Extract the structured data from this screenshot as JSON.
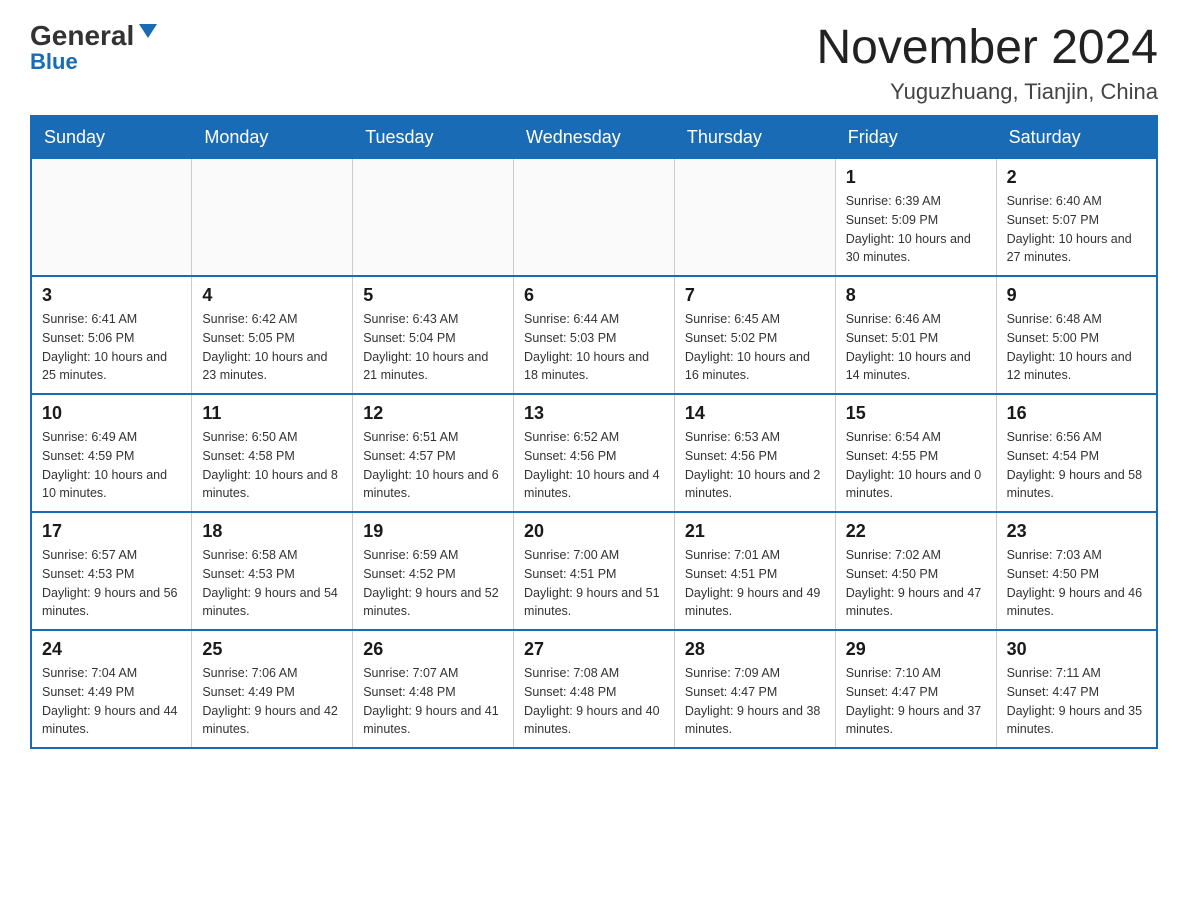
{
  "header": {
    "logo_general": "General",
    "logo_blue": "Blue",
    "month_year": "November 2024",
    "location": "Yuguzhuang, Tianjin, China"
  },
  "days_of_week": [
    "Sunday",
    "Monday",
    "Tuesday",
    "Wednesday",
    "Thursday",
    "Friday",
    "Saturday"
  ],
  "weeks": [
    [
      {
        "day": "",
        "info": ""
      },
      {
        "day": "",
        "info": ""
      },
      {
        "day": "",
        "info": ""
      },
      {
        "day": "",
        "info": ""
      },
      {
        "day": "",
        "info": ""
      },
      {
        "day": "1",
        "info": "Sunrise: 6:39 AM\nSunset: 5:09 PM\nDaylight: 10 hours and 30 minutes."
      },
      {
        "day": "2",
        "info": "Sunrise: 6:40 AM\nSunset: 5:07 PM\nDaylight: 10 hours and 27 minutes."
      }
    ],
    [
      {
        "day": "3",
        "info": "Sunrise: 6:41 AM\nSunset: 5:06 PM\nDaylight: 10 hours and 25 minutes."
      },
      {
        "day": "4",
        "info": "Sunrise: 6:42 AM\nSunset: 5:05 PM\nDaylight: 10 hours and 23 minutes."
      },
      {
        "day": "5",
        "info": "Sunrise: 6:43 AM\nSunset: 5:04 PM\nDaylight: 10 hours and 21 minutes."
      },
      {
        "day": "6",
        "info": "Sunrise: 6:44 AM\nSunset: 5:03 PM\nDaylight: 10 hours and 18 minutes."
      },
      {
        "day": "7",
        "info": "Sunrise: 6:45 AM\nSunset: 5:02 PM\nDaylight: 10 hours and 16 minutes."
      },
      {
        "day": "8",
        "info": "Sunrise: 6:46 AM\nSunset: 5:01 PM\nDaylight: 10 hours and 14 minutes."
      },
      {
        "day": "9",
        "info": "Sunrise: 6:48 AM\nSunset: 5:00 PM\nDaylight: 10 hours and 12 minutes."
      }
    ],
    [
      {
        "day": "10",
        "info": "Sunrise: 6:49 AM\nSunset: 4:59 PM\nDaylight: 10 hours and 10 minutes."
      },
      {
        "day": "11",
        "info": "Sunrise: 6:50 AM\nSunset: 4:58 PM\nDaylight: 10 hours and 8 minutes."
      },
      {
        "day": "12",
        "info": "Sunrise: 6:51 AM\nSunset: 4:57 PM\nDaylight: 10 hours and 6 minutes."
      },
      {
        "day": "13",
        "info": "Sunrise: 6:52 AM\nSunset: 4:56 PM\nDaylight: 10 hours and 4 minutes."
      },
      {
        "day": "14",
        "info": "Sunrise: 6:53 AM\nSunset: 4:56 PM\nDaylight: 10 hours and 2 minutes."
      },
      {
        "day": "15",
        "info": "Sunrise: 6:54 AM\nSunset: 4:55 PM\nDaylight: 10 hours and 0 minutes."
      },
      {
        "day": "16",
        "info": "Sunrise: 6:56 AM\nSunset: 4:54 PM\nDaylight: 9 hours and 58 minutes."
      }
    ],
    [
      {
        "day": "17",
        "info": "Sunrise: 6:57 AM\nSunset: 4:53 PM\nDaylight: 9 hours and 56 minutes."
      },
      {
        "day": "18",
        "info": "Sunrise: 6:58 AM\nSunset: 4:53 PM\nDaylight: 9 hours and 54 minutes."
      },
      {
        "day": "19",
        "info": "Sunrise: 6:59 AM\nSunset: 4:52 PM\nDaylight: 9 hours and 52 minutes."
      },
      {
        "day": "20",
        "info": "Sunrise: 7:00 AM\nSunset: 4:51 PM\nDaylight: 9 hours and 51 minutes."
      },
      {
        "day": "21",
        "info": "Sunrise: 7:01 AM\nSunset: 4:51 PM\nDaylight: 9 hours and 49 minutes."
      },
      {
        "day": "22",
        "info": "Sunrise: 7:02 AM\nSunset: 4:50 PM\nDaylight: 9 hours and 47 minutes."
      },
      {
        "day": "23",
        "info": "Sunrise: 7:03 AM\nSunset: 4:50 PM\nDaylight: 9 hours and 46 minutes."
      }
    ],
    [
      {
        "day": "24",
        "info": "Sunrise: 7:04 AM\nSunset: 4:49 PM\nDaylight: 9 hours and 44 minutes."
      },
      {
        "day": "25",
        "info": "Sunrise: 7:06 AM\nSunset: 4:49 PM\nDaylight: 9 hours and 42 minutes."
      },
      {
        "day": "26",
        "info": "Sunrise: 7:07 AM\nSunset: 4:48 PM\nDaylight: 9 hours and 41 minutes."
      },
      {
        "day": "27",
        "info": "Sunrise: 7:08 AM\nSunset: 4:48 PM\nDaylight: 9 hours and 40 minutes."
      },
      {
        "day": "28",
        "info": "Sunrise: 7:09 AM\nSunset: 4:47 PM\nDaylight: 9 hours and 38 minutes."
      },
      {
        "day": "29",
        "info": "Sunrise: 7:10 AM\nSunset: 4:47 PM\nDaylight: 9 hours and 37 minutes."
      },
      {
        "day": "30",
        "info": "Sunrise: 7:11 AM\nSunset: 4:47 PM\nDaylight: 9 hours and 35 minutes."
      }
    ]
  ]
}
